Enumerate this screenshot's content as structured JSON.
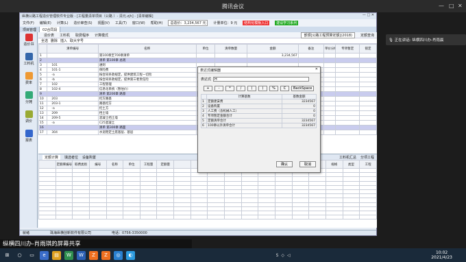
{
  "meeting": {
    "title": "腾讯会议",
    "speaker": "正在讲话: 纵横四川办-肖雨晨",
    "caption": "纵横四川办-肖雨琪的屏幕共享"
  },
  "app": {
    "title": "纵横公路工程造价管理软件专业版 - [工程量清单项目（公路 ）- 清元.zjh] - [清单编辑]",
    "menu": [
      "文件(F)",
      "编辑(E)",
      "计算(L)",
      "造价审查(S)",
      "视图(V)",
      "工具(T)",
      "窗口(W)",
      "帮助(H)"
    ],
    "total_label": "总造价：3,234,567 元",
    "unit_label": "计量单位：9 元",
    "badge1": "结构化模板入口",
    "badge2": "建设学习系列",
    "doc_tabs": [
      "项目管理",
      "02合同段"
    ],
    "sub_tabs": [
      "造价表",
      "工料机",
      "取费程序",
      "计算模式"
    ],
    "sub_right1": "部颁[公路工程预算定额](2018)",
    "sub_right2": "定额查询",
    "toolbar": [
      "全选",
      "删除",
      "插入",
      "取大字号"
    ],
    "left_nav": [
      {
        "label": "造价书",
        "color": "#d33"
      },
      {
        "label": "工料机",
        "color": "#36a"
      },
      {
        "label": "费率",
        "color": "#e93"
      },
      {
        "label": "分摊",
        "color": "#3a7"
      },
      {
        "label": "调价",
        "color": "#9a3"
      },
      {
        "label": "报表",
        "color": "#36c"
      }
    ],
    "grid_headers": [
      "",
      "清单编号",
      "名称",
      "单位",
      "清单数量",
      "金额",
      "备注",
      "单价分析",
      "专项暂定",
      "锁定"
    ],
    "rows": [
      {
        "n": "1",
        "code": "",
        "name": "第100章至700章清单",
        "unit": "",
        "qty": "",
        "amt": "3,234,567",
        "blue": false
      },
      {
        "n": "2",
        "code": "",
        "name": "清单 第100章 总则",
        "unit": "",
        "qty": "",
        "amt": "",
        "blue": true
      },
      {
        "n": "3",
        "code": "101",
        "name": "通则",
        "unit": "",
        "qty": "",
        "amt": "",
        "blue": false
      },
      {
        "n": "4",
        "code": "101-1",
        "name": "保险费",
        "unit": "",
        "qty": "",
        "amt": "",
        "blue": false
      },
      {
        "n": "5",
        "code": "-a",
        "name": "按合同条款规定，提供建筑工程一切险",
        "unit": "总额",
        "qty": "1.000",
        "amt": "",
        "blue": false
      },
      {
        "n": "6",
        "code": "-b",
        "name": "按合同条款规定，提供第三者责任险",
        "unit": "总额",
        "qty": "1.000",
        "amt": "",
        "blue": false
      },
      {
        "n": "7",
        "code": "102",
        "name": "工程管理",
        "unit": "",
        "qty": "",
        "amt": "",
        "blue": false
      },
      {
        "n": "8",
        "code": "102-4",
        "name": "信息化系统（暂估价）",
        "unit": "总额",
        "qty": "1.000",
        "amt": "",
        "blue": false
      },
      {
        "n": "9",
        "code": "",
        "name": "清单 第200章 路基",
        "unit": "",
        "qty": "",
        "amt": "",
        "blue": true
      },
      {
        "n": "10",
        "code": "203",
        "name": "挖方路基",
        "unit": "",
        "qty": "",
        "amt": "",
        "blue": false
      },
      {
        "n": "11",
        "code": "203-1",
        "name": "路基挖方",
        "unit": "",
        "qty": "",
        "amt": "",
        "blue": false
      },
      {
        "n": "12",
        "code": "-a",
        "name": "挖土方",
        "unit": "m3",
        "qty": "21187.000",
        "amt": "",
        "blue": false
      },
      {
        "n": "13",
        "code": "209",
        "name": "挡土墙",
        "unit": "",
        "qty": "",
        "amt": "",
        "blue": false
      },
      {
        "n": "14",
        "code": "209-5",
        "name": "混凝土挡土墙",
        "unit": "",
        "qty": "",
        "amt": "",
        "blue": false
      },
      {
        "n": "15",
        "code": "-a",
        "name": "C25混凝土",
        "unit": "m3",
        "qty": "3730.000",
        "amt": "",
        "blue": false
      },
      {
        "n": "16",
        "code": "",
        "name": "清单 第300章 路面",
        "unit": "",
        "qty": "",
        "amt": "",
        "blue": true
      },
      {
        "n": "17",
        "code": "304",
        "name": "水泥稳定土底基层、基层",
        "unit": "",
        "qty": "",
        "amt": "",
        "blue": false
      }
    ],
    "bottom_tabs": [
      "定额计算",
      "填选者位",
      "设备购置"
    ],
    "bottom_right": [
      "工料机汇总",
      "分项工程"
    ],
    "bottom_headers": [
      "",
      "定额库编号",
      "取费类别",
      "编号",
      "名称",
      "单位",
      "工程量",
      "定额量",
      "",
      "",
      "",
      "",
      "工程量",
      "单价",
      "利润",
      "税金",
      "",
      "规格",
      "类型",
      "工程"
    ],
    "status": [
      "就绪",
      "珠海纵横创新软件有限公司",
      "电话：0756-3350000"
    ]
  },
  "dialog": {
    "title": "表达式编辑器",
    "expr_label": "表达式",
    "expr_value": "H",
    "ops": [
      "+",
      "-",
      "*",
      "/",
      "(",
      ")",
      "%",
      "C",
      "BackSpace"
    ],
    "headers": [
      "",
      "计算基数",
      "基数金额"
    ],
    "rows": [
      {
        "n": "1",
        "name": "定额建安费",
        "amt": "3234567"
      },
      {
        "n": "2",
        "name": "设备购置",
        "amt": "0"
      },
      {
        "n": "3",
        "name": "人工费（含机械人工）",
        "amt": "0"
      },
      {
        "n": "4",
        "name": "专项暂定金额合计",
        "amt": "0"
      },
      {
        "n": "5",
        "name": "定额清单合计",
        "amt": "3234567"
      },
      {
        "n": "6",
        "name": "100章以外清单合计",
        "amt": "3234567"
      }
    ],
    "ok": "确认",
    "cancel": "取消"
  },
  "taskbar": {
    "time": "10:02",
    "date": "2021/4/23"
  }
}
